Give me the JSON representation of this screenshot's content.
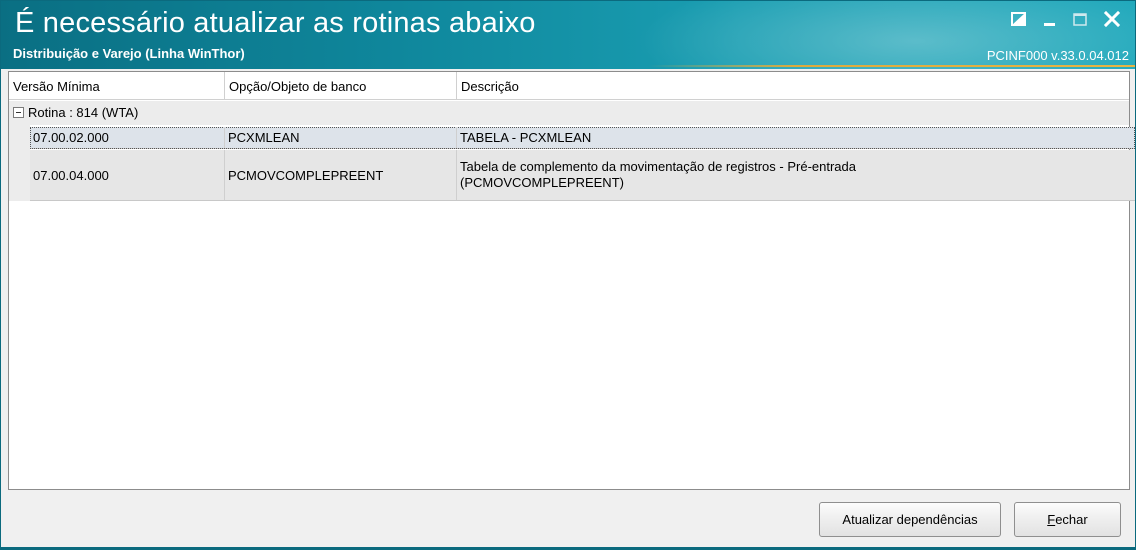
{
  "window": {
    "title": "É necessário atualizar as rotinas abaixo",
    "subtitle": "Distribuição e Varejo (Linha WinThor)",
    "version": "PCINF000  v.33.0.04.012",
    "controls": [
      "restore-down-icon",
      "minimize-icon",
      "maximize-icon",
      "close-icon"
    ],
    "accent_color": "#0f879c"
  },
  "grid": {
    "columns": [
      "Versão Mínima",
      "Opção/Objeto de banco",
      "Descrição"
    ],
    "group": {
      "label": "Rotina : 814 (WTA)",
      "expanded": true
    },
    "rows": [
      {
        "versao": "07.00.02.000",
        "objeto": "PCXMLEAN",
        "descricao": "TABELA - PCXMLEAN",
        "selected": true
      },
      {
        "versao": "07.00.04.000",
        "objeto": "PCMOVCOMPLEPREENT",
        "descricao": "Tabela de complemento da movimentação de registros - Pré-entrada (PCMOVCOMPLEPREENT)",
        "selected": false
      }
    ]
  },
  "footer": {
    "update_button": "Atualizar dependências",
    "close_button_accel": "F",
    "close_button_rest": "echar"
  }
}
